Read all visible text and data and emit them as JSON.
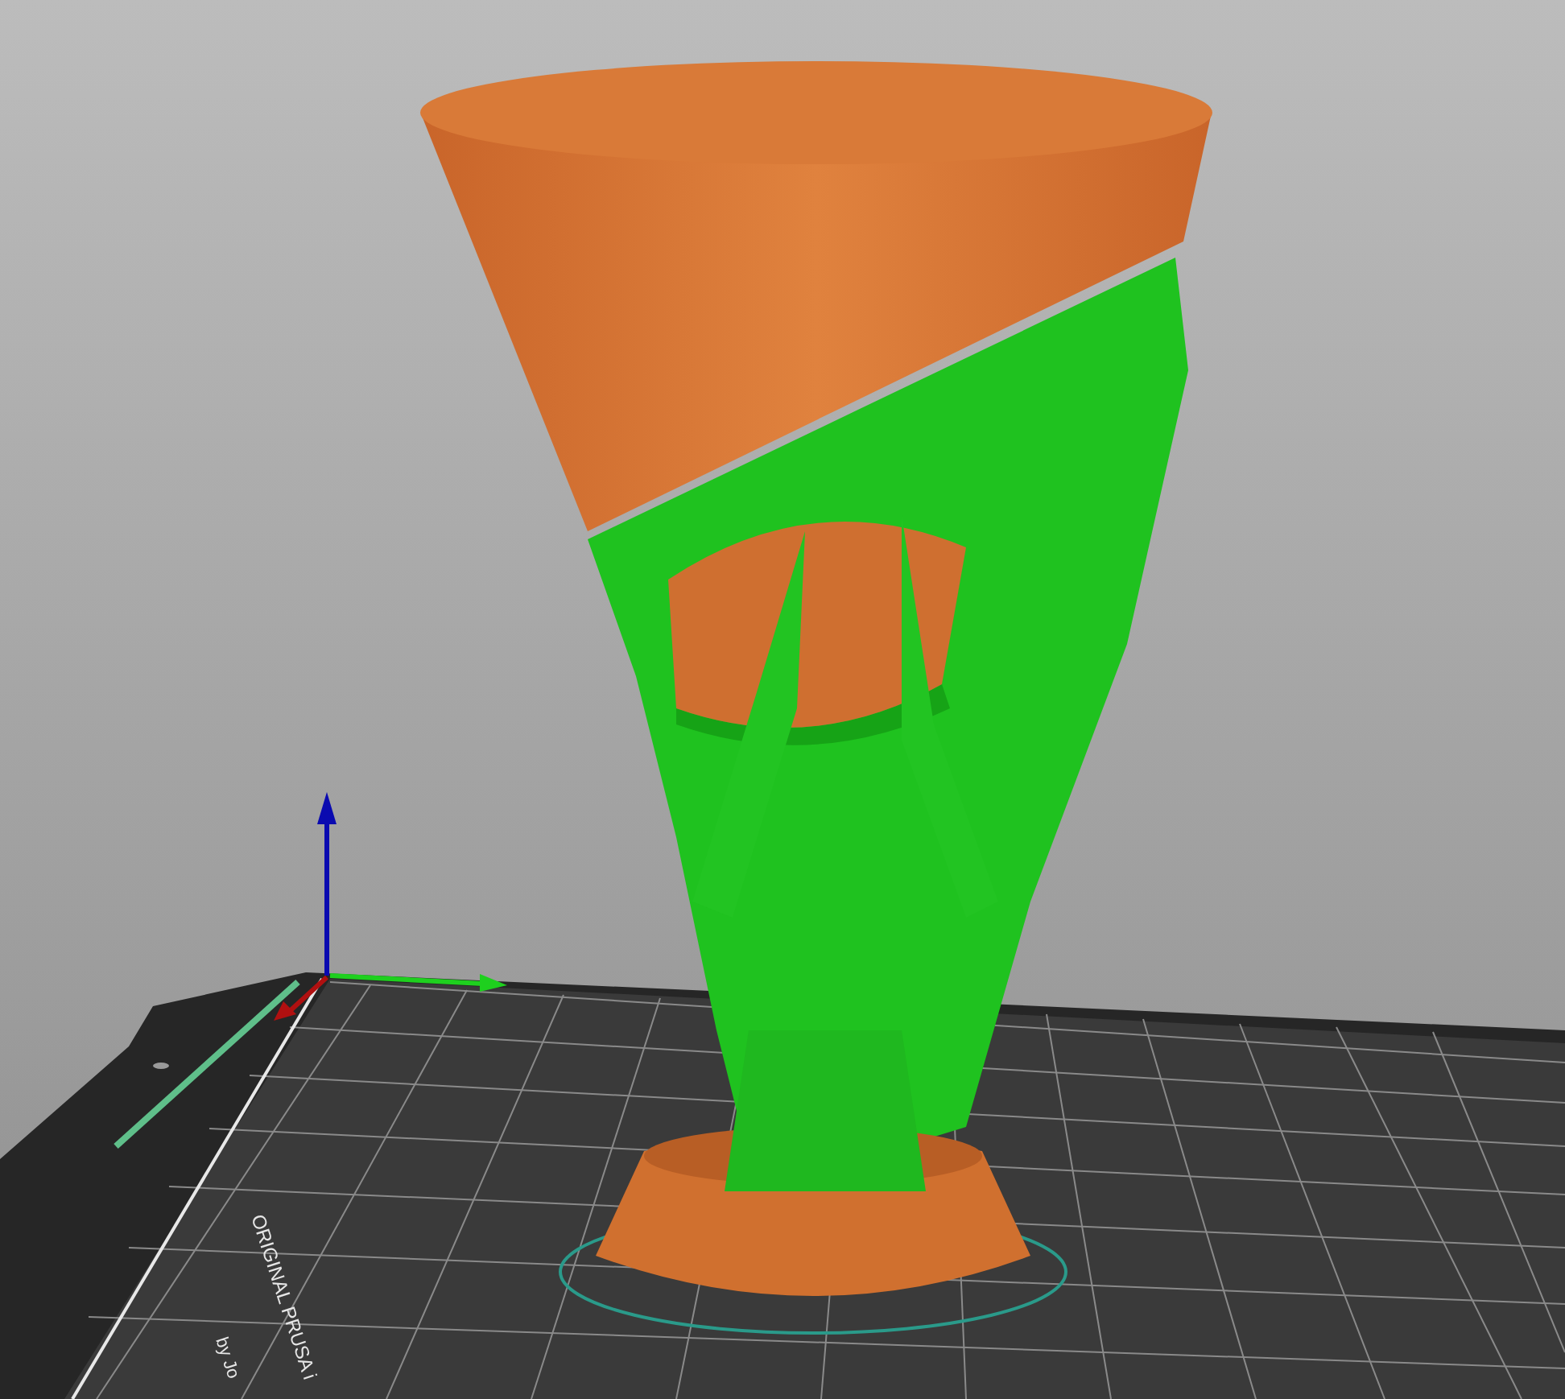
{
  "scene": {
    "bed_label": [
      "ORIGINAL PRUSA i",
      "by Jo"
    ]
  }
}
